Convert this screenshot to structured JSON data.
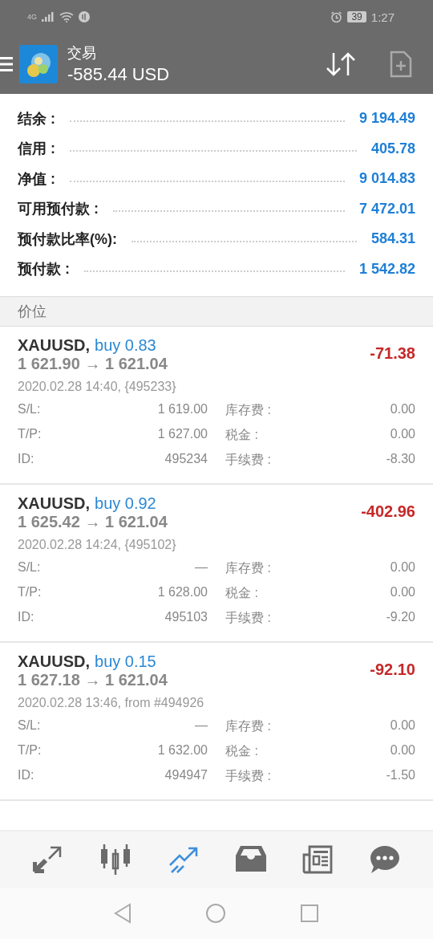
{
  "status_bar": {
    "network": "4G",
    "battery": "39",
    "time": "1:27"
  },
  "header": {
    "title": "交易",
    "balance": "-585.44 USD"
  },
  "summary": [
    {
      "label": "结余 :",
      "value": "9 194.49"
    },
    {
      "label": "信用 :",
      "value": "405.78"
    },
    {
      "label": "净值 :",
      "value": "9 014.83"
    },
    {
      "label": "可用预付款 :",
      "value": "7 472.01"
    },
    {
      "label": "预付款比率(%):",
      "value": "584.31"
    },
    {
      "label": "预付款 :",
      "value": "1 542.82"
    }
  ],
  "section_title": "价位",
  "positions": [
    {
      "symbol": "XAUUSD,",
      "order": "buy 0.83",
      "prices": "1 621.90 → 1 621.04",
      "profit": "-71.38",
      "opened": "2020.02.28 14:40, {495233}",
      "details": [
        {
          "label": "S/L:",
          "value": "1 619.00"
        },
        {
          "label": "库存费 :",
          "value": "0.00"
        },
        {
          "label": "T/P:",
          "value": "1 627.00"
        },
        {
          "label": "税金 :",
          "value": "0.00"
        },
        {
          "label": "ID:",
          "value": "495234"
        },
        {
          "label": "手续费 :",
          "value": "-8.30"
        }
      ]
    },
    {
      "symbol": "XAUUSD,",
      "order": "buy 0.92",
      "prices": "1 625.42 → 1 621.04",
      "profit": "-402.96",
      "opened": "2020.02.28 14:24, {495102}",
      "details": [
        {
          "label": "S/L:",
          "value": "—"
        },
        {
          "label": "库存费 :",
          "value": "0.00"
        },
        {
          "label": "T/P:",
          "value": "1 628.00"
        },
        {
          "label": "税金 :",
          "value": "0.00"
        },
        {
          "label": "ID:",
          "value": "495103"
        },
        {
          "label": "手续费 :",
          "value": "-9.20"
        }
      ]
    },
    {
      "symbol": "XAUUSD,",
      "order": "buy 0.15",
      "prices": "1 627.18 → 1 621.04",
      "profit": "-92.10",
      "opened": "2020.02.28 13:46, from #494926",
      "details": [
        {
          "label": "S/L:",
          "value": "—"
        },
        {
          "label": "库存费 :",
          "value": "0.00"
        },
        {
          "label": "T/P:",
          "value": "1 632.00"
        },
        {
          "label": "税金 :",
          "value": "0.00"
        },
        {
          "label": "ID:",
          "value": "494947"
        },
        {
          "label": "手续费 :",
          "value": "-1.50"
        }
      ]
    }
  ],
  "bottom_nav": [
    {
      "kind": "trade",
      "selected": false
    },
    {
      "kind": "chart",
      "selected": false
    },
    {
      "kind": "history",
      "selected": true
    },
    {
      "kind": "inbox",
      "selected": false
    },
    {
      "kind": "news",
      "selected": false
    },
    {
      "kind": "chat",
      "selected": false
    }
  ]
}
